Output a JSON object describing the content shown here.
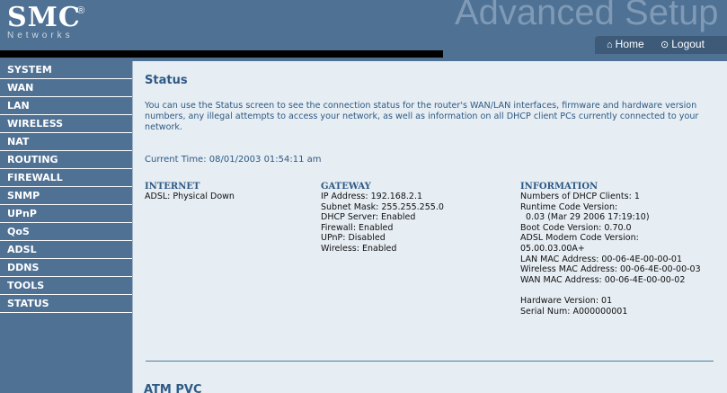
{
  "header": {
    "logo_text": "SMC",
    "logo_reg": "®",
    "logo_sub": "Networks",
    "banner_text": "Advanced Setup",
    "home_label": "Home",
    "logout_label": "Logout",
    "home_icon": "home-icon",
    "logout_icon": "logout-icon"
  },
  "sidebar": {
    "items": [
      {
        "label": "SYSTEM"
      },
      {
        "label": "WAN"
      },
      {
        "label": "LAN"
      },
      {
        "label": "WIRELESS"
      },
      {
        "label": "NAT"
      },
      {
        "label": "ROUTING"
      },
      {
        "label": "FIREWALL"
      },
      {
        "label": "SNMP"
      },
      {
        "label": "UPnP"
      },
      {
        "label": "QoS"
      },
      {
        "label": "ADSL"
      },
      {
        "label": "DDNS"
      },
      {
        "label": "TOOLS"
      },
      {
        "label": "STATUS"
      }
    ]
  },
  "main": {
    "title": "Status",
    "intro": "You can use the Status screen to see the connection status for the router's WAN/LAN interfaces, firmware and hardware version numbers, any illegal attempts to access your network, as well as information on all DHCP client PCs currently connected to your network.",
    "current_time": "Current Time: 08/01/2003 01:54:11 am",
    "internet": {
      "heading": "INTERNET",
      "lines": [
        "ADSL:  Physical Down"
      ]
    },
    "gateway": {
      "heading": "GATEWAY",
      "lines": [
        "IP Address:  192.168.2.1",
        "Subnet Mask:  255.255.255.0",
        "DHCP Server:  Enabled",
        "Firewall:  Enabled",
        "UPnP:  Disabled",
        "Wireless:  Enabled"
      ]
    },
    "information": {
      "heading": "INFORMATION",
      "lines": [
        "Numbers of DHCP Clients:  1",
        "Runtime Code Version:",
        "  0.03 (Mar 29 2006 17:19:10)",
        "Boot Code Version:  0.70.0",
        "ADSL Modem Code Version:",
        "05.00.03.00A+",
        "LAN MAC Address:  00-06-4E-00-00-01",
        "Wireless MAC Address:  00-06-4E-00-00-03",
        "WAN MAC Address:  00-06-4E-00-00-02",
        "",
        "Hardware Version:  01",
        "Serial Num:   A000000001"
      ]
    },
    "atm_title": "ATM PVC"
  },
  "colors": {
    "sidebar_bg": "#4f7194",
    "content_bg": "#e6edf3",
    "heading": "#2e5a84"
  }
}
